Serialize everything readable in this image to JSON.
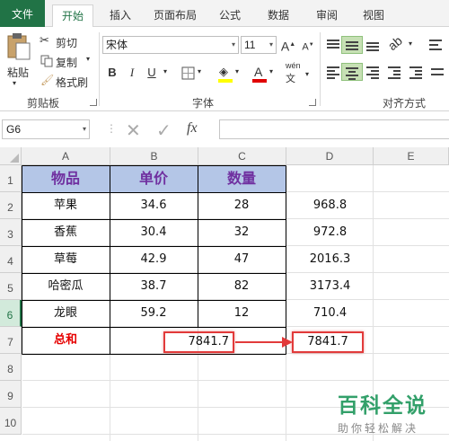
{
  "tabs": [
    "文件",
    "开始",
    "插入",
    "页面布局",
    "公式",
    "数据",
    "审阅",
    "视图"
  ],
  "clipboard": {
    "paste": "粘贴",
    "cut": "剪切",
    "copy": "复制",
    "format_painter": "格式刷",
    "label": "剪贴板"
  },
  "font": {
    "name": "宋体",
    "size": "11",
    "label": "字体",
    "bold": "B",
    "italic": "I",
    "underline": "U",
    "grow": "A",
    "shrink": "A",
    "wen": "wén\n文"
  },
  "alignment": {
    "label": "对齐方式"
  },
  "formula_bar": {
    "name_box": "G6",
    "fx": "fx",
    "cancel": "✕",
    "enter": "✓"
  },
  "columns": [
    "A",
    "B",
    "C",
    "D",
    "E"
  ],
  "rows": [
    "1",
    "2",
    "3",
    "4",
    "5",
    "6",
    "7",
    "8",
    "9",
    "10"
  ],
  "table": {
    "headers": [
      "物品",
      "单价",
      "数量"
    ],
    "items": [
      {
        "name": "苹果",
        "price": "34.6",
        "qty": "28",
        "total": "968.8"
      },
      {
        "name": "香蕉",
        "price": "30.4",
        "qty": "32",
        "total": "972.8"
      },
      {
        "name": "草莓",
        "price": "42.9",
        "qty": "47",
        "total": "2016.3"
      },
      {
        "name": "哈密瓜",
        "price": "38.7",
        "qty": "82",
        "total": "3173.4"
      },
      {
        "name": "龙眼",
        "price": "59.2",
        "qty": "12",
        "total": "710.4"
      }
    ],
    "sum_label": "总和",
    "sum_value": "7841.7",
    "sum_copy": "7841.7"
  },
  "watermark": {
    "title": "百科全说",
    "subtitle": "助你轻松解决"
  },
  "colors": {
    "accent": "#217346",
    "header_fill": "#b4c6e7",
    "header_text": "#7030a0",
    "sum_text": "#e60000",
    "annotation": "#e23a3a"
  }
}
